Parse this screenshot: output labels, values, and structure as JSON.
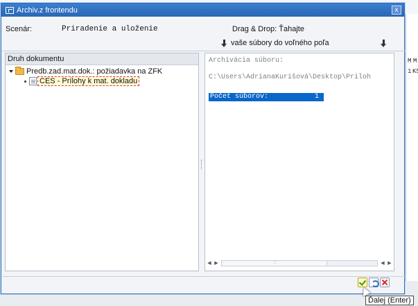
{
  "window": {
    "title": "Archiv.z frontendu",
    "close_label": "x"
  },
  "scenario": {
    "label": "Scenár:",
    "value": "Priradenie a uloženie"
  },
  "drag_drop": {
    "title": "Drag & Drop: Ťahajte",
    "subtitle": "vaše súbory do voľného poľa"
  },
  "tree": {
    "header": "Druh dokumentu",
    "items": [
      {
        "label": "Predb.zad.mat.dok.: požiadavka na ZFK"
      },
      {
        "label": "CES - Prílohy k mat. dokladu"
      }
    ]
  },
  "output": {
    "line1": "Archivácia súboru:",
    "line2": "C:\\Users\\AdrianaKurišová\\Desktop\\Priloh",
    "count_label": "Počet súborov:",
    "count_value": "1"
  },
  "background": {
    "col_a": "M",
    "col_b": "M",
    "cell_a": "1",
    "cell_b": "KS"
  },
  "tooltip": "Ďalej  (Enter)"
}
